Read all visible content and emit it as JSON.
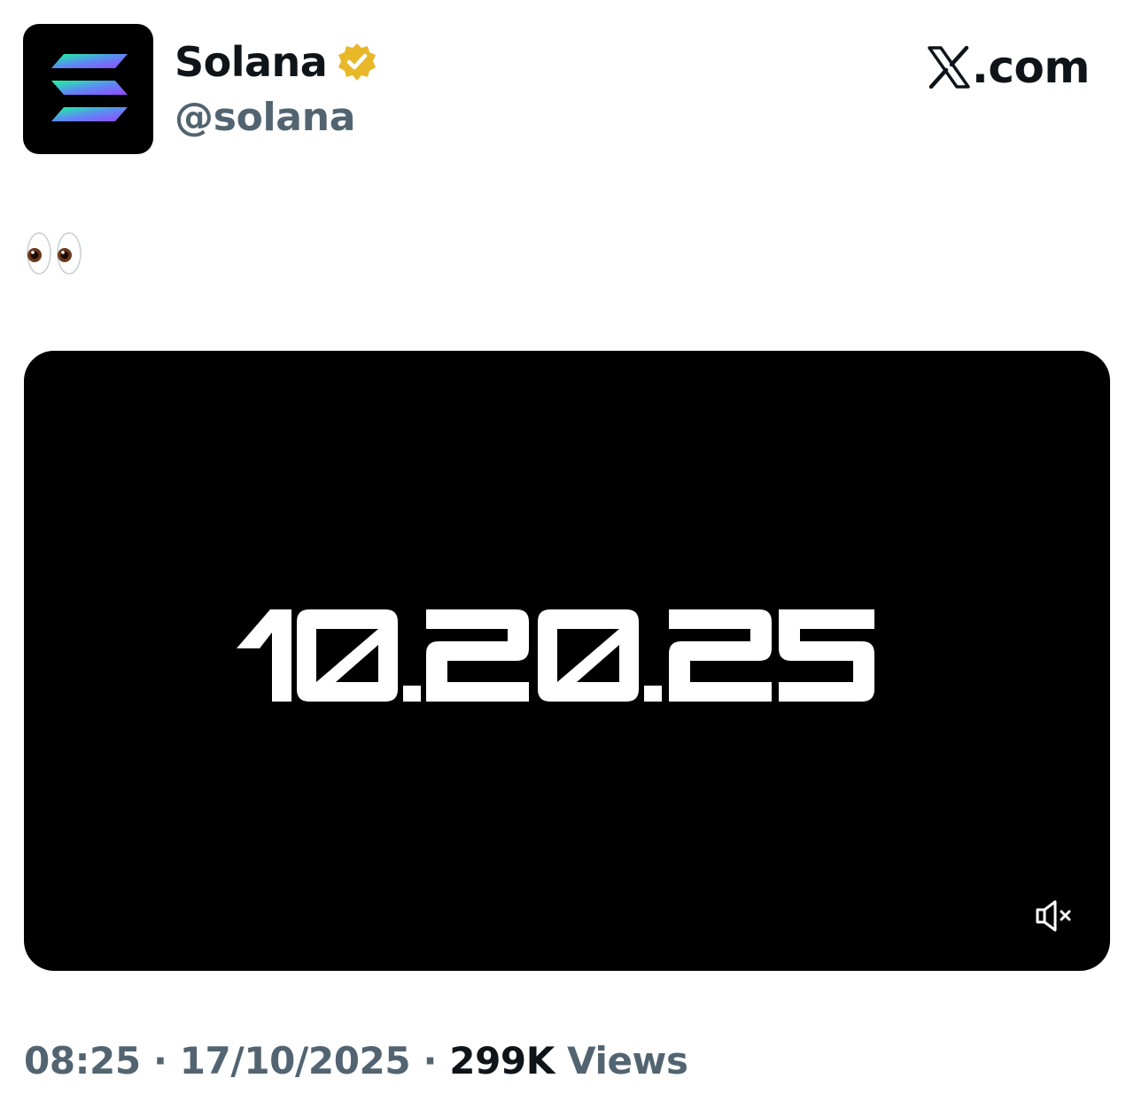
{
  "author": {
    "display_name": "Solana",
    "handle": "@solana",
    "verified": true,
    "avatar_icon": "solana-logo-icon",
    "verified_icon": "gold-verified-badge-icon"
  },
  "brand": {
    "logo_icon": "x-logo-icon",
    "domain": ".com"
  },
  "post": {
    "text": "👀",
    "text_icon": "eyes-emoji-icon",
    "media": {
      "type": "video",
      "display_text": "10.20.25",
      "mute_icon": "speaker-muted-icon"
    }
  },
  "meta": {
    "time": "08:25",
    "separator": "·",
    "date": "17/10/2025",
    "views_count": "299K",
    "views_label": "Views"
  },
  "colors": {
    "text_primary": "#0f1419",
    "text_secondary": "#536471",
    "media_background": "#000000",
    "verified_gold": "#e8b829",
    "solana_teal": "#19fb9b",
    "solana_purple": "#9945ff"
  }
}
